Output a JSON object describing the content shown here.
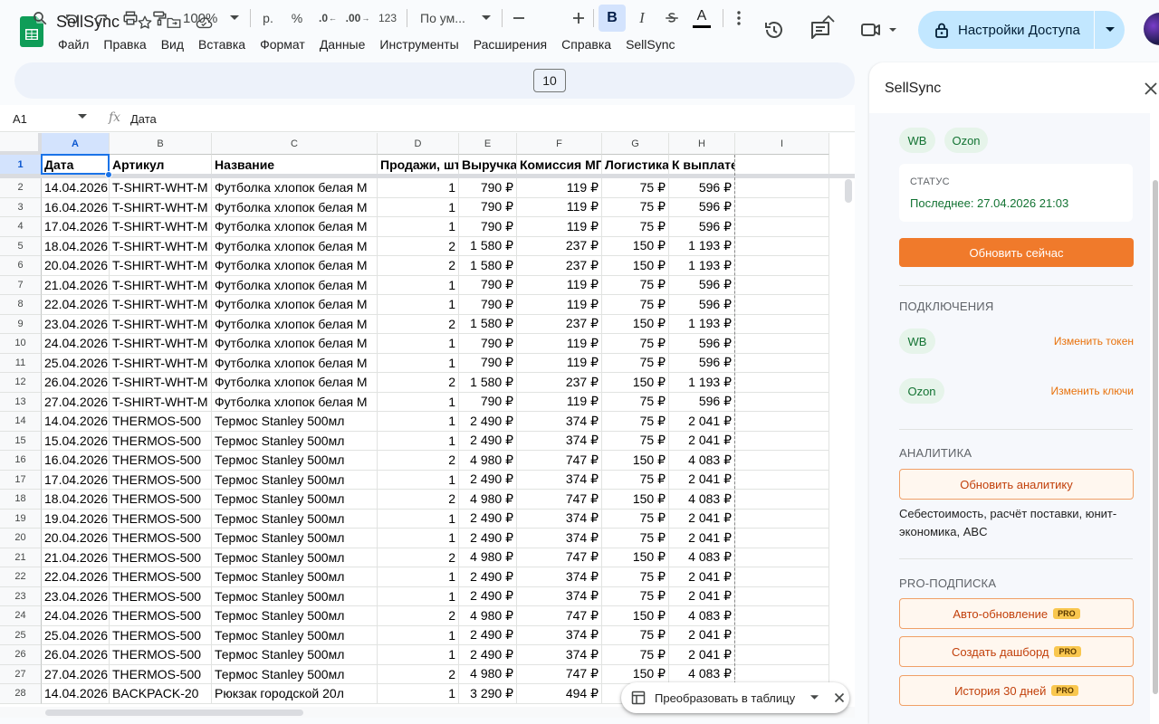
{
  "app": {
    "doc_title": "SellSync",
    "menu": [
      "Файл",
      "Правка",
      "Вид",
      "Вставка",
      "Формат",
      "Данные",
      "Инструменты",
      "Расширения",
      "Справка",
      "SellSync"
    ],
    "share_label": "Настройки Доступа"
  },
  "toolbar": {
    "zoom": "100%",
    "currency": "р.",
    "percent": "%",
    "dec_minus": ".0",
    "dec_plus": ".00",
    "number_format": "123",
    "font_name": "По ум...",
    "font_size": "10"
  },
  "formula_bar": {
    "cell_ref": "A1",
    "fx": "fx",
    "value": "Дата"
  },
  "sheet": {
    "columns": [
      "A",
      "B",
      "C",
      "D",
      "E",
      "F",
      "G",
      "H",
      "I"
    ],
    "headers": [
      "Дата",
      "Артикул",
      "Название",
      "Продажи, шт",
      "Выручка",
      "Комиссия МП",
      "Логистика",
      "К выплате"
    ],
    "rows": [
      [
        "14.04.2026",
        "T-SHIRT-WHT-M",
        "Футболка хлопок белая M",
        "1",
        "790 ₽",
        "119 ₽",
        "75 ₽",
        "596 ₽"
      ],
      [
        "16.04.2026",
        "T-SHIRT-WHT-M",
        "Футболка хлопок белая M",
        "1",
        "790 ₽",
        "119 ₽",
        "75 ₽",
        "596 ₽"
      ],
      [
        "17.04.2026",
        "T-SHIRT-WHT-M",
        "Футболка хлопок белая M",
        "1",
        "790 ₽",
        "119 ₽",
        "75 ₽",
        "596 ₽"
      ],
      [
        "18.04.2026",
        "T-SHIRT-WHT-M",
        "Футболка хлопок белая M",
        "2",
        "1 580 ₽",
        "237 ₽",
        "150 ₽",
        "1 193 ₽"
      ],
      [
        "20.04.2026",
        "T-SHIRT-WHT-M",
        "Футболка хлопок белая M",
        "2",
        "1 580 ₽",
        "237 ₽",
        "150 ₽",
        "1 193 ₽"
      ],
      [
        "21.04.2026",
        "T-SHIRT-WHT-M",
        "Футболка хлопок белая M",
        "1",
        "790 ₽",
        "119 ₽",
        "75 ₽",
        "596 ₽"
      ],
      [
        "22.04.2026",
        "T-SHIRT-WHT-M",
        "Футболка хлопок белая M",
        "1",
        "790 ₽",
        "119 ₽",
        "75 ₽",
        "596 ₽"
      ],
      [
        "23.04.2026",
        "T-SHIRT-WHT-M",
        "Футболка хлопок белая M",
        "2",
        "1 580 ₽",
        "237 ₽",
        "150 ₽",
        "1 193 ₽"
      ],
      [
        "24.04.2026",
        "T-SHIRT-WHT-M",
        "Футболка хлопок белая M",
        "1",
        "790 ₽",
        "119 ₽",
        "75 ₽",
        "596 ₽"
      ],
      [
        "25.04.2026",
        "T-SHIRT-WHT-M",
        "Футболка хлопок белая M",
        "1",
        "790 ₽",
        "119 ₽",
        "75 ₽",
        "596 ₽"
      ],
      [
        "26.04.2026",
        "T-SHIRT-WHT-M",
        "Футболка хлопок белая M",
        "2",
        "1 580 ₽",
        "237 ₽",
        "150 ₽",
        "1 193 ₽"
      ],
      [
        "27.04.2026",
        "T-SHIRT-WHT-M",
        "Футболка хлопок белая M",
        "1",
        "790 ₽",
        "119 ₽",
        "75 ₽",
        "596 ₽"
      ],
      [
        "14.04.2026",
        "THERMOS-500",
        "Термос Stanley 500мл",
        "1",
        "2 490 ₽",
        "374 ₽",
        "75 ₽",
        "2 041 ₽"
      ],
      [
        "15.04.2026",
        "THERMOS-500",
        "Термос Stanley 500мл",
        "1",
        "2 490 ₽",
        "374 ₽",
        "75 ₽",
        "2 041 ₽"
      ],
      [
        "16.04.2026",
        "THERMOS-500",
        "Термос Stanley 500мл",
        "2",
        "4 980 ₽",
        "747 ₽",
        "150 ₽",
        "4 083 ₽"
      ],
      [
        "17.04.2026",
        "THERMOS-500",
        "Термос Stanley 500мл",
        "1",
        "2 490 ₽",
        "374 ₽",
        "75 ₽",
        "2 041 ₽"
      ],
      [
        "18.04.2026",
        "THERMOS-500",
        "Термос Stanley 500мл",
        "2",
        "4 980 ₽",
        "747 ₽",
        "150 ₽",
        "4 083 ₽"
      ],
      [
        "19.04.2026",
        "THERMOS-500",
        "Термос Stanley 500мл",
        "1",
        "2 490 ₽",
        "374 ₽",
        "75 ₽",
        "2 041 ₽"
      ],
      [
        "20.04.2026",
        "THERMOS-500",
        "Термос Stanley 500мл",
        "1",
        "2 490 ₽",
        "374 ₽",
        "75 ₽",
        "2 041 ₽"
      ],
      [
        "21.04.2026",
        "THERMOS-500",
        "Термос Stanley 500мл",
        "2",
        "4 980 ₽",
        "747 ₽",
        "150 ₽",
        "4 083 ₽"
      ],
      [
        "22.04.2026",
        "THERMOS-500",
        "Термос Stanley 500мл",
        "1",
        "2 490 ₽",
        "374 ₽",
        "75 ₽",
        "2 041 ₽"
      ],
      [
        "23.04.2026",
        "THERMOS-500",
        "Термос Stanley 500мл",
        "1",
        "2 490 ₽",
        "374 ₽",
        "75 ₽",
        "2 041 ₽"
      ],
      [
        "24.04.2026",
        "THERMOS-500",
        "Термос Stanley 500мл",
        "2",
        "4 980 ₽",
        "747 ₽",
        "150 ₽",
        "4 083 ₽"
      ],
      [
        "25.04.2026",
        "THERMOS-500",
        "Термос Stanley 500мл",
        "1",
        "2 490 ₽",
        "374 ₽",
        "75 ₽",
        "2 041 ₽"
      ],
      [
        "26.04.2026",
        "THERMOS-500",
        "Термос Stanley 500мл",
        "1",
        "2 490 ₽",
        "374 ₽",
        "75 ₽",
        "2 041 ₽"
      ],
      [
        "27.04.2026",
        "THERMOS-500",
        "Термос Stanley 500мл",
        "2",
        "4 980 ₽",
        "747 ₽",
        "150 ₽",
        "4 083 ₽"
      ],
      [
        "14.04.2026",
        "BACKPACK-20",
        "Рюкзак городской 20л",
        "1",
        "3 290 ₽",
        "494 ₽",
        "",
        ""
      ]
    ]
  },
  "toast": {
    "label": "Преобразовать в таблицу"
  },
  "panel": {
    "title": "SellSync",
    "marketplaces": [
      "WB",
      "Ozon"
    ],
    "status": {
      "label": "СТАТУС",
      "value": "Последнее: 27.04.2026 21:03"
    },
    "update_now": "Обновить сейчас",
    "connections": {
      "title": "ПОДКЛЮЧЕНИЯ",
      "items": [
        {
          "name": "WB",
          "action": "Изменить токен"
        },
        {
          "name": "Ozon",
          "action": "Изменить ключи"
        }
      ]
    },
    "analytics": {
      "title": "АНАЛИТИКА",
      "button": "Обновить аналитику",
      "description": "Себестоимость, расчёт поставки, юнит-экономика, ABC"
    },
    "pro": {
      "title": "PRO-ПОДПИСКА",
      "badge": "PRO",
      "buttons": [
        "Авто-обновление",
        "Создать дашборд",
        "История 30 дней"
      ]
    }
  },
  "colors": {
    "accent_blue": "#1a73e8",
    "share_bg": "#c2e7ff",
    "orange": "#f07a2b",
    "green_text": "#137333",
    "chip_green": "#e6f4ea"
  }
}
